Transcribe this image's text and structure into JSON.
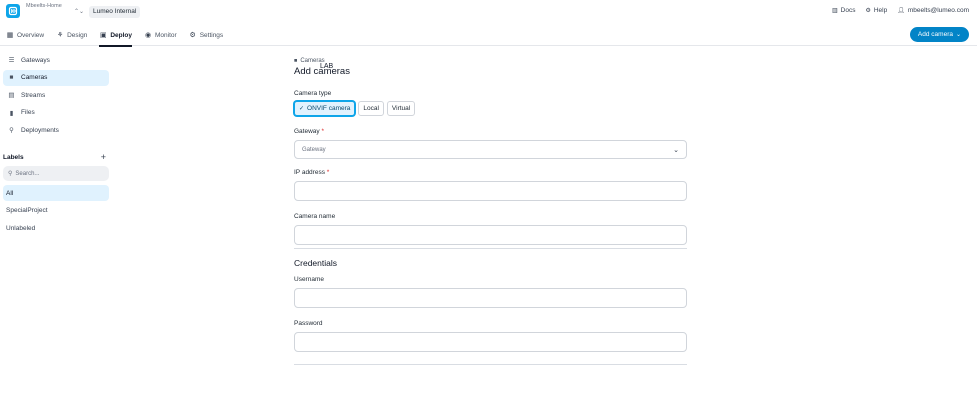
{
  "app": {
    "org_name": "Mbeelts-Home",
    "workspace_short": "LAB",
    "workspace_name": "Lumeo Internal",
    "brand_color": "#0ea5e9"
  },
  "top_right": {
    "docs": "Docs",
    "help": "Help",
    "user_email": "mbeelts@lumeo.com"
  },
  "nav": {
    "tabs": [
      {
        "label": "Overview",
        "icon": "grid-icon"
      },
      {
        "label": "Design",
        "icon": "design-icon"
      },
      {
        "label": "Deploy",
        "icon": "deploy-icon",
        "active": true
      },
      {
        "label": "Monitor",
        "icon": "monitor-icon"
      },
      {
        "label": "Settings",
        "icon": "gear-icon"
      }
    ],
    "add_camera_label": "Add camera",
    "add_camera_color": "#0284c7"
  },
  "sidebar": {
    "items": [
      {
        "label": "Gateways",
        "icon": "gateway-icon"
      },
      {
        "label": "Cameras",
        "icon": "camera-icon",
        "active": true
      },
      {
        "label": "Streams",
        "icon": "stream-icon"
      },
      {
        "label": "Files",
        "icon": "file-icon"
      },
      {
        "label": "Deployments",
        "icon": "deployment-icon"
      }
    ],
    "labels_title": "Labels",
    "search_placeholder": "Search...",
    "labels": [
      {
        "label": "All",
        "active": true
      },
      {
        "label": "SpecialProject"
      },
      {
        "label": "Unlabeled"
      }
    ]
  },
  "form": {
    "breadcrumb": "Cameras",
    "title": "Add cameras",
    "camera_type_label": "Camera type",
    "camera_types": [
      "ONVIF camera",
      "Local",
      "Virtual"
    ],
    "selected_type": "ONVIF camera",
    "gateway_label": "Gateway",
    "gateway_placeholder": "Gateway",
    "ip_label": "IP address",
    "ip_value": "",
    "camera_name_label": "Camera name",
    "camera_name_value": "",
    "credentials_title": "Credentials",
    "username_label": "Username",
    "username_value": "",
    "password_label": "Password",
    "password_value": "",
    "required_mark": "*"
  }
}
